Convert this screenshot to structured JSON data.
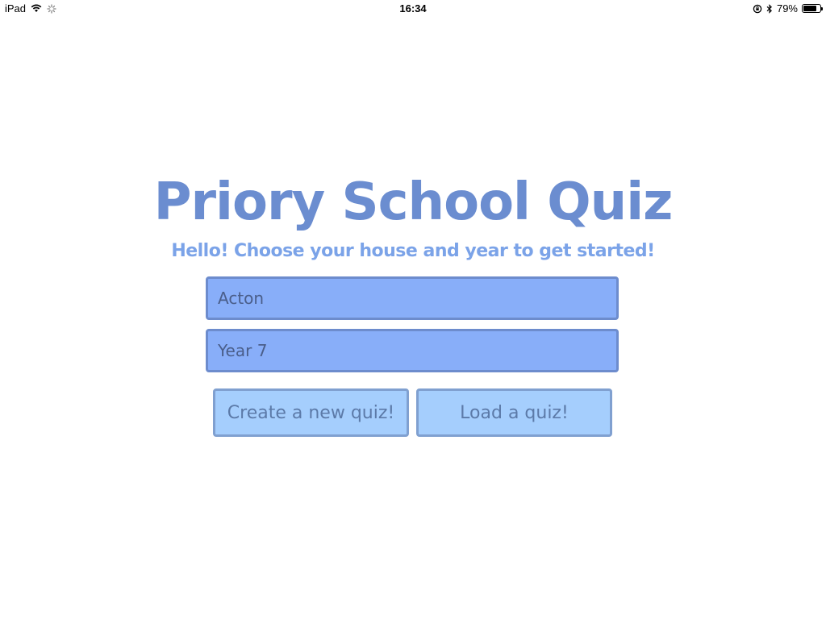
{
  "status_bar": {
    "device": "iPad",
    "time": "16:34",
    "battery_percent": "79%",
    "battery_level": 0.79,
    "icons": [
      "wifi-icon",
      "activity-spinner-icon",
      "orientation-lock-icon",
      "bluetooth-icon",
      "battery-icon"
    ]
  },
  "app": {
    "title": "Priory School Quiz",
    "subtitle": "Hello! Choose your house and year to get started!"
  },
  "form": {
    "house_value": "Acton",
    "year_value": "Year 7"
  },
  "actions": {
    "create_label": "Create a new quiz!",
    "load_label": "Load a quiz!"
  },
  "colors": {
    "title": "#6b8dd0",
    "subtitle": "#7ba3e8",
    "select_bg": "#88aef9",
    "button_bg": "#a5cefd"
  }
}
